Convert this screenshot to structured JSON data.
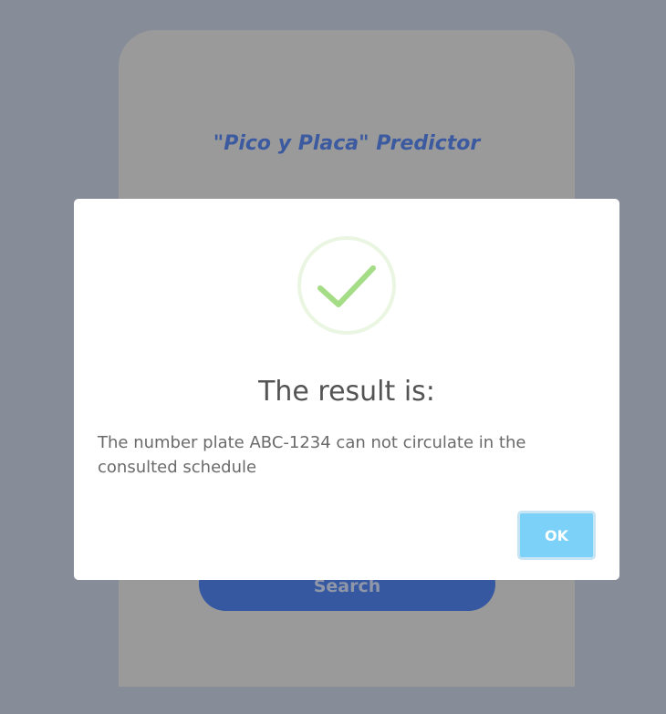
{
  "app": {
    "title": "\"Pico y Placa\" Predictor",
    "search_label": "Search"
  },
  "modal": {
    "icon": "success-check-icon",
    "title": "The result is:",
    "message": "The number plate ABC-1234 can not circulate in the consulted schedule",
    "ok_label": "OK"
  },
  "colors": {
    "backdrop": "#868c98",
    "card": "#9a9a9a",
    "title": "#3c5aa0",
    "search_button": "#3558a0",
    "check": "#a5dc86",
    "ok_button": "#7cd1f9"
  }
}
